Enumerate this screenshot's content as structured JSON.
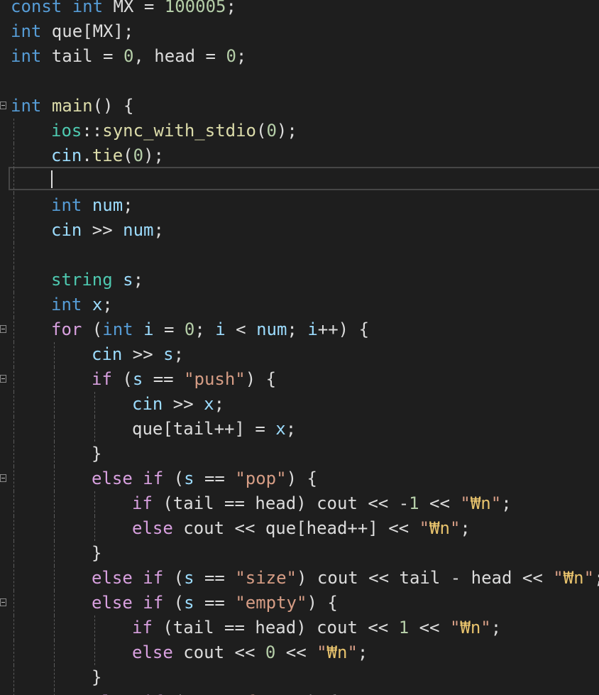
{
  "editor": {
    "colors": {
      "background": "#1e1e1e",
      "keyword": "#569cd6",
      "control": "#d8a0df",
      "type": "#4ec9b0",
      "function": "#dcdcaa",
      "variable": "#9cdcfe",
      "string": "#d69d85",
      "number": "#b5cea8",
      "escape": "#e8c36d"
    },
    "lines": [
      {
        "indent": 0,
        "fold": false,
        "guides": 0,
        "tokens": [
          [
            "kw",
            "const"
          ],
          [
            "plain",
            " "
          ],
          [
            "kw",
            "int"
          ],
          [
            "plain",
            " MX = "
          ],
          [
            "num",
            "100005"
          ],
          [
            "plain",
            ";"
          ]
        ]
      },
      {
        "indent": 0,
        "fold": false,
        "guides": 0,
        "tokens": [
          [
            "kw",
            "int"
          ],
          [
            "plain",
            " que[MX];"
          ]
        ]
      },
      {
        "indent": 0,
        "fold": false,
        "guides": 0,
        "tokens": [
          [
            "kw",
            "int"
          ],
          [
            "plain",
            " tail = "
          ],
          [
            "num",
            "0"
          ],
          [
            "plain",
            ", head = "
          ],
          [
            "num",
            "0"
          ],
          [
            "plain",
            ";"
          ]
        ]
      },
      {
        "indent": 0,
        "fold": false,
        "guides": 0,
        "tokens": []
      },
      {
        "indent": 0,
        "fold": true,
        "guides": 0,
        "tokens": [
          [
            "kw",
            "int"
          ],
          [
            "plain",
            " "
          ],
          [
            "fn",
            "main"
          ],
          [
            "plain",
            "() {"
          ]
        ]
      },
      {
        "indent": 1,
        "fold": false,
        "guides": 1,
        "tokens": [
          [
            "ns",
            "ios"
          ],
          [
            "plain",
            "::"
          ],
          [
            "fn",
            "sync_with_stdio"
          ],
          [
            "plain",
            "("
          ],
          [
            "num",
            "0"
          ],
          [
            "plain",
            ");"
          ]
        ]
      },
      {
        "indent": 1,
        "fold": false,
        "guides": 1,
        "tokens": [
          [
            "var",
            "cin"
          ],
          [
            "plain",
            "."
          ],
          [
            "fn",
            "tie"
          ],
          [
            "plain",
            "("
          ],
          [
            "num",
            "0"
          ],
          [
            "plain",
            ");"
          ]
        ]
      },
      {
        "indent": 1,
        "fold": false,
        "guides": 1,
        "tokens": []
      },
      {
        "indent": 1,
        "fold": false,
        "guides": 1,
        "tokens": [
          [
            "kw",
            "int"
          ],
          [
            "plain",
            " "
          ],
          [
            "var",
            "num"
          ],
          [
            "plain",
            ";"
          ]
        ]
      },
      {
        "indent": 1,
        "fold": false,
        "guides": 1,
        "tokens": [
          [
            "var",
            "cin"
          ],
          [
            "plain",
            " >> "
          ],
          [
            "var",
            "num"
          ],
          [
            "plain",
            ";"
          ]
        ]
      },
      {
        "indent": 1,
        "fold": false,
        "guides": 1,
        "tokens": []
      },
      {
        "indent": 1,
        "fold": false,
        "guides": 1,
        "tokens": [
          [
            "type",
            "string"
          ],
          [
            "plain",
            " "
          ],
          [
            "var",
            "s"
          ],
          [
            "plain",
            ";"
          ]
        ]
      },
      {
        "indent": 1,
        "fold": false,
        "guides": 1,
        "tokens": [
          [
            "kw",
            "int"
          ],
          [
            "plain",
            " "
          ],
          [
            "var",
            "x"
          ],
          [
            "plain",
            ";"
          ]
        ]
      },
      {
        "indent": 1,
        "fold": true,
        "guides": 1,
        "tokens": [
          [
            "ctl",
            "for"
          ],
          [
            "plain",
            " ("
          ],
          [
            "kw",
            "int"
          ],
          [
            "plain",
            " "
          ],
          [
            "var",
            "i"
          ],
          [
            "plain",
            " = "
          ],
          [
            "num",
            "0"
          ],
          [
            "plain",
            "; "
          ],
          [
            "var",
            "i"
          ],
          [
            "plain",
            " < "
          ],
          [
            "var",
            "num"
          ],
          [
            "plain",
            "; "
          ],
          [
            "var",
            "i"
          ],
          [
            "plain",
            "++) {"
          ]
        ]
      },
      {
        "indent": 2,
        "fold": false,
        "guides": 2,
        "tokens": [
          [
            "var",
            "cin"
          ],
          [
            "plain",
            " >> "
          ],
          [
            "var",
            "s"
          ],
          [
            "plain",
            ";"
          ]
        ]
      },
      {
        "indent": 2,
        "fold": true,
        "guides": 2,
        "tokens": [
          [
            "ctl",
            "if"
          ],
          [
            "plain",
            " ("
          ],
          [
            "var",
            "s"
          ],
          [
            "plain",
            " == "
          ],
          [
            "str",
            "\"push\""
          ],
          [
            "plain",
            ") {"
          ]
        ]
      },
      {
        "indent": 3,
        "fold": false,
        "guides": 3,
        "tokens": [
          [
            "var",
            "cin"
          ],
          [
            "plain",
            " >> "
          ],
          [
            "var",
            "x"
          ],
          [
            "plain",
            ";"
          ]
        ]
      },
      {
        "indent": 3,
        "fold": false,
        "guides": 3,
        "tokens": [
          [
            "plain",
            "que[tail++] = "
          ],
          [
            "var",
            "x"
          ],
          [
            "plain",
            ";"
          ]
        ]
      },
      {
        "indent": 2,
        "fold": false,
        "guides": 2,
        "tokens": [
          [
            "plain",
            "}"
          ]
        ]
      },
      {
        "indent": 2,
        "fold": true,
        "guides": 2,
        "tokens": [
          [
            "ctl",
            "else"
          ],
          [
            "plain",
            " "
          ],
          [
            "ctl",
            "if"
          ],
          [
            "plain",
            " ("
          ],
          [
            "var",
            "s"
          ],
          [
            "plain",
            " == "
          ],
          [
            "str",
            "\"pop\""
          ],
          [
            "plain",
            ") {"
          ]
        ]
      },
      {
        "indent": 3,
        "fold": false,
        "guides": 3,
        "tokens": [
          [
            "ctl",
            "if"
          ],
          [
            "plain",
            " (tail == head) cout << -"
          ],
          [
            "num",
            "1"
          ],
          [
            "plain",
            " << "
          ],
          [
            "str",
            "\""
          ],
          [
            "esc",
            "₩n"
          ],
          [
            "str",
            "\""
          ],
          [
            "plain",
            ";"
          ]
        ]
      },
      {
        "indent": 3,
        "fold": false,
        "guides": 3,
        "tokens": [
          [
            "ctl",
            "else"
          ],
          [
            "plain",
            " cout << que[head++] << "
          ],
          [
            "str",
            "\""
          ],
          [
            "esc",
            "₩n"
          ],
          [
            "str",
            "\""
          ],
          [
            "plain",
            ";"
          ]
        ]
      },
      {
        "indent": 2,
        "fold": false,
        "guides": 2,
        "tokens": [
          [
            "plain",
            "}"
          ]
        ]
      },
      {
        "indent": 2,
        "fold": false,
        "guides": 2,
        "tokens": [
          [
            "ctl",
            "else"
          ],
          [
            "plain",
            " "
          ],
          [
            "ctl",
            "if"
          ],
          [
            "plain",
            " ("
          ],
          [
            "var",
            "s"
          ],
          [
            "plain",
            " == "
          ],
          [
            "str",
            "\"size\""
          ],
          [
            "plain",
            ") cout << tail - head << "
          ],
          [
            "str",
            "\""
          ],
          [
            "esc",
            "₩n"
          ],
          [
            "str",
            "\""
          ],
          [
            "plain",
            ";"
          ]
        ]
      },
      {
        "indent": 2,
        "fold": true,
        "guides": 2,
        "tokens": [
          [
            "ctl",
            "else"
          ],
          [
            "plain",
            " "
          ],
          [
            "ctl",
            "if"
          ],
          [
            "plain",
            " ("
          ],
          [
            "var",
            "s"
          ],
          [
            "plain",
            " == "
          ],
          [
            "str",
            "\"empty\""
          ],
          [
            "plain",
            ") {"
          ]
        ]
      },
      {
        "indent": 3,
        "fold": false,
        "guides": 3,
        "tokens": [
          [
            "ctl",
            "if"
          ],
          [
            "plain",
            " (tail == head) cout << "
          ],
          [
            "num",
            "1"
          ],
          [
            "plain",
            " << "
          ],
          [
            "str",
            "\""
          ],
          [
            "esc",
            "₩n"
          ],
          [
            "str",
            "\""
          ],
          [
            "plain",
            ";"
          ]
        ]
      },
      {
        "indent": 3,
        "fold": false,
        "guides": 3,
        "tokens": [
          [
            "ctl",
            "else"
          ],
          [
            "plain",
            " cout << "
          ],
          [
            "num",
            "0"
          ],
          [
            "plain",
            " << "
          ],
          [
            "str",
            "\""
          ],
          [
            "esc",
            "₩n"
          ],
          [
            "str",
            "\""
          ],
          [
            "plain",
            ";"
          ]
        ]
      },
      {
        "indent": 2,
        "fold": false,
        "guides": 2,
        "tokens": [
          [
            "plain",
            "}"
          ]
        ]
      },
      {
        "indent": 2,
        "fold": false,
        "guides": 2,
        "tokens": [
          [
            "ctl",
            "else"
          ],
          [
            "plain",
            " "
          ],
          [
            "ctl",
            "if"
          ],
          [
            "plain",
            " ("
          ],
          [
            "var",
            "s"
          ],
          [
            "plain",
            " == "
          ],
          [
            "str",
            "\"front\""
          ],
          [
            "plain",
            ") {"
          ]
        ]
      }
    ]
  }
}
